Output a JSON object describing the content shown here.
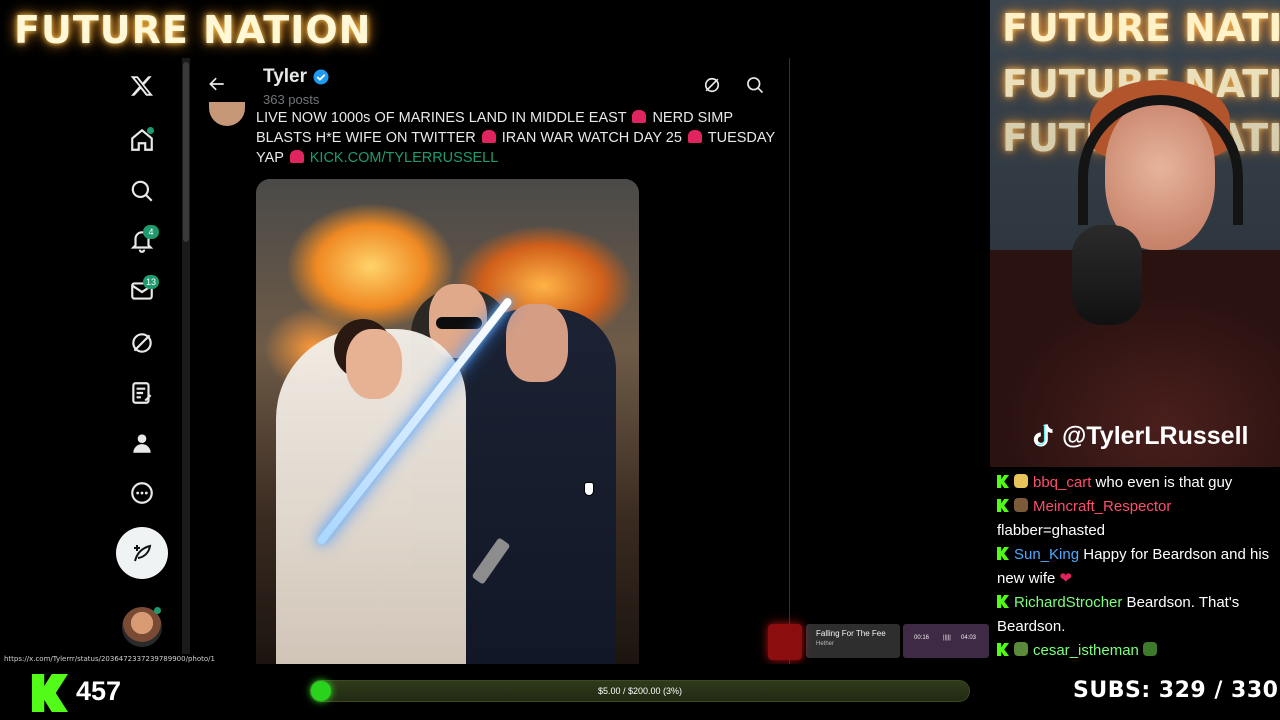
{
  "overlay": {
    "brand": "FUTURE NATION",
    "cam_logo_lines": [
      "FUTURE NATION",
      "FUTURE NATION",
      "FUTURE NATION"
    ],
    "tiktok_handle": "@TylerLRussell",
    "kick_count": "457",
    "goal_text": "$5.00 / $200.00 (3%)",
    "goal_fraction": 0.03,
    "subs_text": "SUBS:  329 / 330"
  },
  "sidebar": {
    "badges": {
      "notifications": "4",
      "messages": "13"
    }
  },
  "profile": {
    "name": "Tyler",
    "post_count": "363 posts"
  },
  "tweet": {
    "line_parts": [
      "LIVE NOW 1000s OF MARINES LAND IN MIDDLE EAST",
      "NERD SIMP BLASTS H*E WIFE ON TWITTER",
      "IRAN WAR WATCH DAY 25",
      "TUESDAY YAP"
    ],
    "link": "KICK.COM/TYLERRUSSELL"
  },
  "status_url": "https://x.com/Tylerrr/status/2036472337239789900/photo/1",
  "player": {
    "title": "Falling For The Fee",
    "artist": "Hether",
    "time_start": "00:16",
    "time_end": "04:03"
  },
  "chat": [
    {
      "user": "bbq_cart",
      "color": "#ff4d6d",
      "text": " who even is that guy",
      "emote": "#e8c35a"
    },
    {
      "user": "Meincraft_Respector",
      "color": "#ff4d6d",
      "text": " flabber=ghasted",
      "emote": "#7b5a3a"
    },
    {
      "user": "Sun_King",
      "color": "#4fa9ff",
      "text": " Happy for Beardson and his new wife ",
      "heart": "❤"
    },
    {
      "user": "RichardStrocher",
      "color": "#7cff7c",
      "text": " Beardson. That's Beardson."
    },
    {
      "user": "cesar_istheman",
      "color": "#7cff7c",
      "text": "",
      "emote": "#5a8a3a"
    }
  ],
  "colors": {
    "accent_green": "#1d9b6e",
    "kick_green": "#53fc18",
    "verified_blue": "#1d9bf0"
  }
}
